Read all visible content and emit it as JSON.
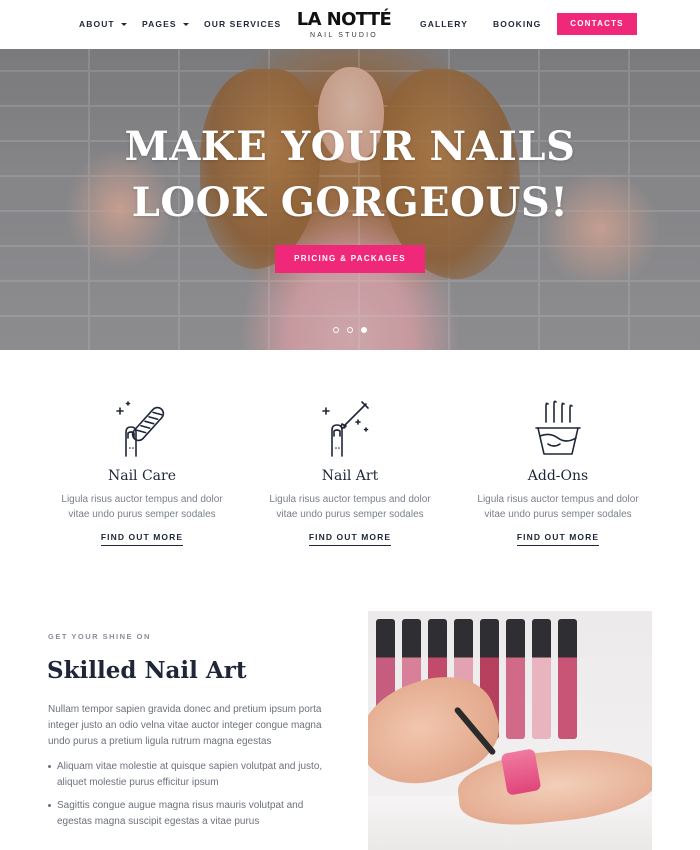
{
  "header": {
    "nav_left": [
      {
        "label": "ABOUT",
        "has_dropdown": true
      },
      {
        "label": "PAGES",
        "has_dropdown": true
      },
      {
        "label": "OUR SERVICES",
        "has_dropdown": false
      }
    ],
    "logo": {
      "main": "LA NOTTÉ",
      "sub": "NAIL STUDIO"
    },
    "nav_right": [
      {
        "label": "GALLERY"
      },
      {
        "label": "BOOKING"
      }
    ],
    "contacts_label": "CONTACTS"
  },
  "hero": {
    "title_line1": "MAKE YOUR NAILS",
    "title_line2": "LOOK GORGEOUS!",
    "button_label": "PRICING & PACKAGES",
    "slides": 3,
    "active_slide": 3
  },
  "services": [
    {
      "icon": "nail-file-icon",
      "title": "Nail Care",
      "desc": "Ligula risus auctor tempus and dolor vitae undo purus semper sodales",
      "link": "FIND OUT MORE"
    },
    {
      "icon": "nail-polish-brush-icon",
      "title": "Nail Art",
      "desc": "Ligula risus auctor tempus and dolor vitae undo purus semper sodales",
      "link": "FIND OUT MORE"
    },
    {
      "icon": "soak-bowl-icon",
      "title": "Add-Ons",
      "desc": "Ligula risus auctor tempus and dolor vitae undo purus semper sodales",
      "link": "FIND OUT MORE"
    }
  ],
  "feature": {
    "eyebrow": "GET YOUR SHINE ON",
    "title": "Skilled Nail Art",
    "paragraph": "Nullam tempor sapien gravida donec and pretium ipsum porta integer justo an odio velna vitae auctor integer congue magna undo purus a pretium ligula rutrum magna egestas",
    "bullets": [
      "Aliquam vitae molestie at quisque sapien volutpat and justo, aliquet molestie purus efficitur ipsum",
      "Sagittis congue augue magna risus mauris volutpat and egestas magna suscipit egestas a vitae purus"
    ]
  },
  "colors": {
    "accent": "#f0287a",
    "heading": "#1f2638",
    "body_text": "#6c717e"
  }
}
